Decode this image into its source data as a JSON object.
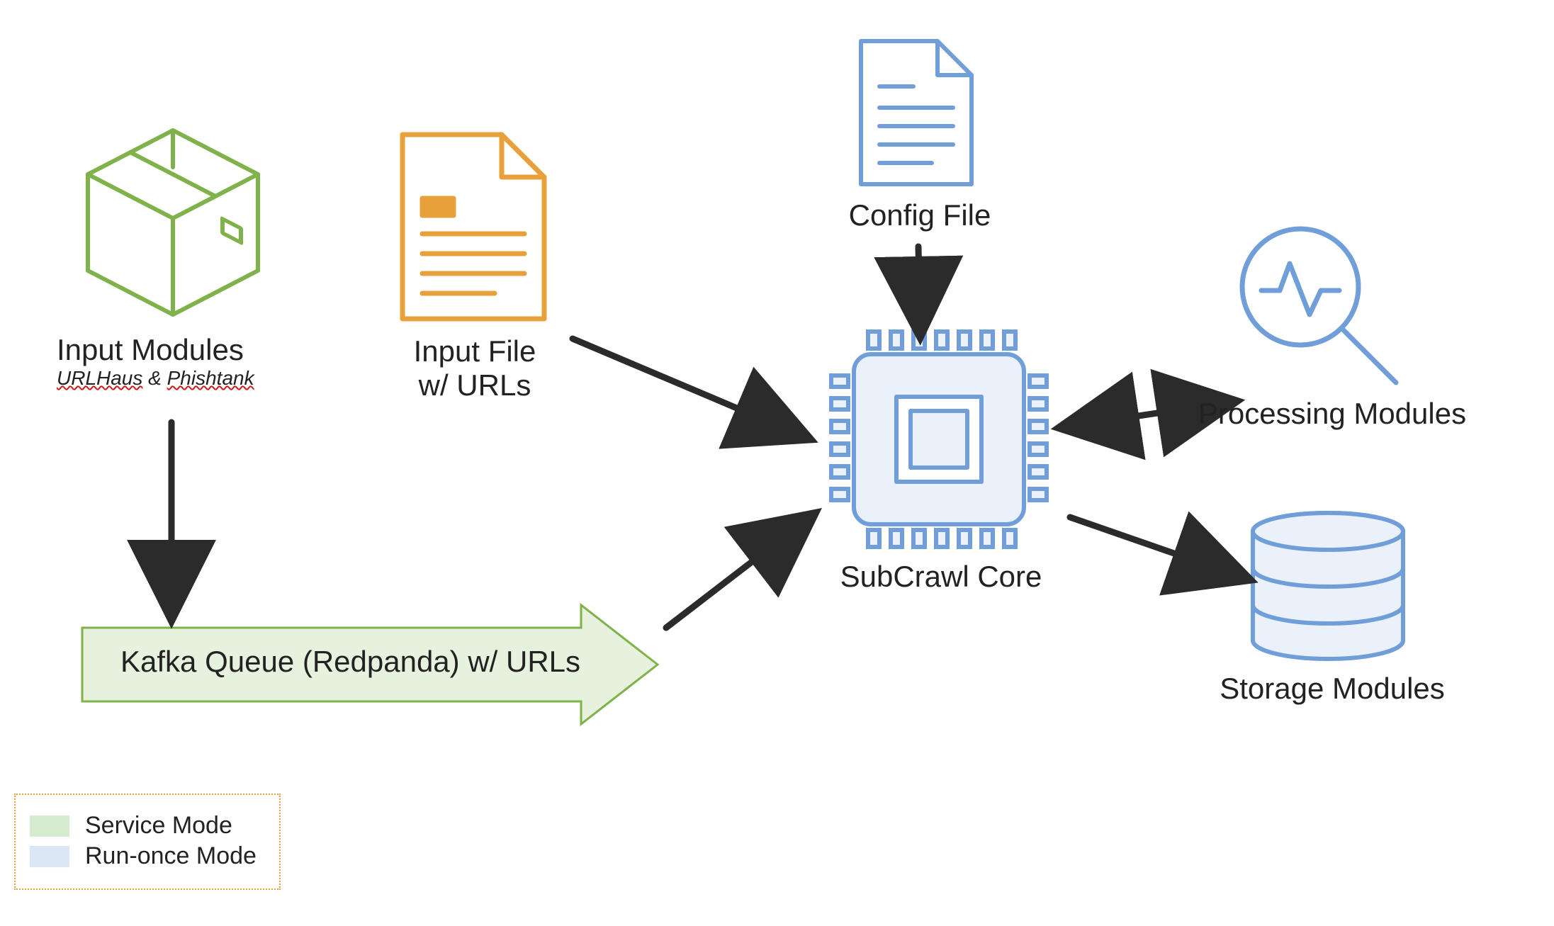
{
  "nodes": {
    "input_modules": {
      "title": "Input Modules",
      "subtitle_prefix": "URLHaus",
      "subtitle_mid": " & ",
      "subtitle_wavy": "Phishtank"
    },
    "input_file": {
      "title_line1": "Input File",
      "title_line2": "w/ URLs"
    },
    "config_file": {
      "title": "Config File"
    },
    "subcrawl_core": {
      "title": "SubCrawl Core"
    },
    "processing_modules": {
      "title": "Processing Modules"
    },
    "storage_modules": {
      "title": "Storage Modules"
    },
    "kafka_queue": {
      "title": "Kafka Queue (Redpanda) w/ URLs"
    }
  },
  "legend": {
    "service_mode": "Service Mode",
    "run_once_mode": "Run-once Mode"
  },
  "colors": {
    "green_stroke": "#7fb24a",
    "green_fill": "#d7ebcf",
    "orange_stroke": "#e8a13a",
    "blue_stroke": "#6f9ed9",
    "blue_fill": "#dbe7f5",
    "arrow": "#2b2b2b"
  }
}
